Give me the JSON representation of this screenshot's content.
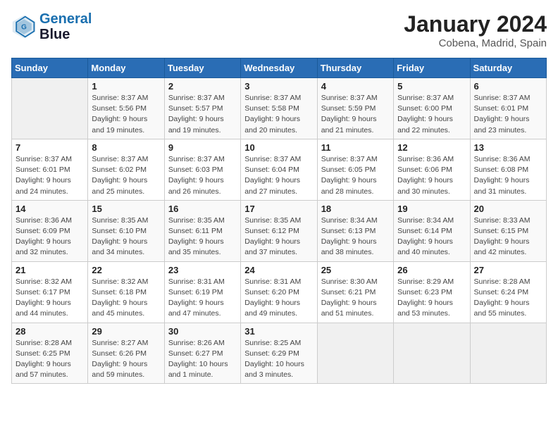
{
  "header": {
    "logo_line1": "General",
    "logo_line2": "Blue",
    "month_year": "January 2024",
    "location": "Cobena, Madrid, Spain"
  },
  "weekdays": [
    "Sunday",
    "Monday",
    "Tuesday",
    "Wednesday",
    "Thursday",
    "Friday",
    "Saturday"
  ],
  "weeks": [
    [
      {
        "day": "",
        "info": ""
      },
      {
        "day": "1",
        "info": "Sunrise: 8:37 AM\nSunset: 5:56 PM\nDaylight: 9 hours\nand 19 minutes."
      },
      {
        "day": "2",
        "info": "Sunrise: 8:37 AM\nSunset: 5:57 PM\nDaylight: 9 hours\nand 19 minutes."
      },
      {
        "day": "3",
        "info": "Sunrise: 8:37 AM\nSunset: 5:58 PM\nDaylight: 9 hours\nand 20 minutes."
      },
      {
        "day": "4",
        "info": "Sunrise: 8:37 AM\nSunset: 5:59 PM\nDaylight: 9 hours\nand 21 minutes."
      },
      {
        "day": "5",
        "info": "Sunrise: 8:37 AM\nSunset: 6:00 PM\nDaylight: 9 hours\nand 22 minutes."
      },
      {
        "day": "6",
        "info": "Sunrise: 8:37 AM\nSunset: 6:01 PM\nDaylight: 9 hours\nand 23 minutes."
      }
    ],
    [
      {
        "day": "7",
        "info": "Sunrise: 8:37 AM\nSunset: 6:01 PM\nDaylight: 9 hours\nand 24 minutes."
      },
      {
        "day": "8",
        "info": "Sunrise: 8:37 AM\nSunset: 6:02 PM\nDaylight: 9 hours\nand 25 minutes."
      },
      {
        "day": "9",
        "info": "Sunrise: 8:37 AM\nSunset: 6:03 PM\nDaylight: 9 hours\nand 26 minutes."
      },
      {
        "day": "10",
        "info": "Sunrise: 8:37 AM\nSunset: 6:04 PM\nDaylight: 9 hours\nand 27 minutes."
      },
      {
        "day": "11",
        "info": "Sunrise: 8:37 AM\nSunset: 6:05 PM\nDaylight: 9 hours\nand 28 minutes."
      },
      {
        "day": "12",
        "info": "Sunrise: 8:36 AM\nSunset: 6:06 PM\nDaylight: 9 hours\nand 30 minutes."
      },
      {
        "day": "13",
        "info": "Sunrise: 8:36 AM\nSunset: 6:08 PM\nDaylight: 9 hours\nand 31 minutes."
      }
    ],
    [
      {
        "day": "14",
        "info": "Sunrise: 8:36 AM\nSunset: 6:09 PM\nDaylight: 9 hours\nand 32 minutes."
      },
      {
        "day": "15",
        "info": "Sunrise: 8:35 AM\nSunset: 6:10 PM\nDaylight: 9 hours\nand 34 minutes."
      },
      {
        "day": "16",
        "info": "Sunrise: 8:35 AM\nSunset: 6:11 PM\nDaylight: 9 hours\nand 35 minutes."
      },
      {
        "day": "17",
        "info": "Sunrise: 8:35 AM\nSunset: 6:12 PM\nDaylight: 9 hours\nand 37 minutes."
      },
      {
        "day": "18",
        "info": "Sunrise: 8:34 AM\nSunset: 6:13 PM\nDaylight: 9 hours\nand 38 minutes."
      },
      {
        "day": "19",
        "info": "Sunrise: 8:34 AM\nSunset: 6:14 PM\nDaylight: 9 hours\nand 40 minutes."
      },
      {
        "day": "20",
        "info": "Sunrise: 8:33 AM\nSunset: 6:15 PM\nDaylight: 9 hours\nand 42 minutes."
      }
    ],
    [
      {
        "day": "21",
        "info": "Sunrise: 8:32 AM\nSunset: 6:17 PM\nDaylight: 9 hours\nand 44 minutes."
      },
      {
        "day": "22",
        "info": "Sunrise: 8:32 AM\nSunset: 6:18 PM\nDaylight: 9 hours\nand 45 minutes."
      },
      {
        "day": "23",
        "info": "Sunrise: 8:31 AM\nSunset: 6:19 PM\nDaylight: 9 hours\nand 47 minutes."
      },
      {
        "day": "24",
        "info": "Sunrise: 8:31 AM\nSunset: 6:20 PM\nDaylight: 9 hours\nand 49 minutes."
      },
      {
        "day": "25",
        "info": "Sunrise: 8:30 AM\nSunset: 6:21 PM\nDaylight: 9 hours\nand 51 minutes."
      },
      {
        "day": "26",
        "info": "Sunrise: 8:29 AM\nSunset: 6:23 PM\nDaylight: 9 hours\nand 53 minutes."
      },
      {
        "day": "27",
        "info": "Sunrise: 8:28 AM\nSunset: 6:24 PM\nDaylight: 9 hours\nand 55 minutes."
      }
    ],
    [
      {
        "day": "28",
        "info": "Sunrise: 8:28 AM\nSunset: 6:25 PM\nDaylight: 9 hours\nand 57 minutes."
      },
      {
        "day": "29",
        "info": "Sunrise: 8:27 AM\nSunset: 6:26 PM\nDaylight: 9 hours\nand 59 minutes."
      },
      {
        "day": "30",
        "info": "Sunrise: 8:26 AM\nSunset: 6:27 PM\nDaylight: 10 hours\nand 1 minute."
      },
      {
        "day": "31",
        "info": "Sunrise: 8:25 AM\nSunset: 6:29 PM\nDaylight: 10 hours\nand 3 minutes."
      },
      {
        "day": "",
        "info": ""
      },
      {
        "day": "",
        "info": ""
      },
      {
        "day": "",
        "info": ""
      }
    ]
  ]
}
